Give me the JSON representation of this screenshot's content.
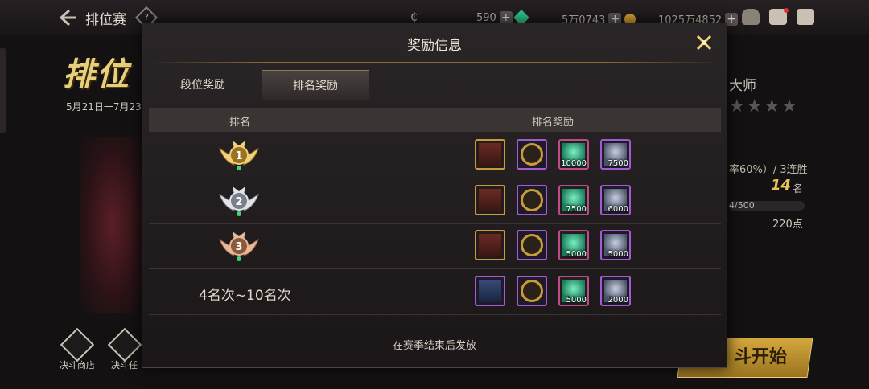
{
  "header": {
    "title": "排位赛",
    "help_symbol": "?",
    "currencies": [
      {
        "name": "currency-a",
        "value": "590",
        "color": "#2fc48a"
      },
      {
        "name": "currency-b",
        "value": "5万0743",
        "color": "#d4a030"
      },
      {
        "name": "currency-c",
        "value": "1025万4852"
      }
    ]
  },
  "background": {
    "banner": "排位",
    "date_range": "5月21日一7月23",
    "right_title": "大师",
    "stars": "★★★★",
    "winrate": "率60%）/ 3连胜",
    "rank_number": "14",
    "rank_suffix": "名",
    "progress_text": "4/500",
    "points": "220点",
    "start_button": "斗开始",
    "bottom_nav": [
      {
        "label": "决斗商店"
      },
      {
        "label": "决斗任"
      }
    ]
  },
  "modal": {
    "title": "奖励信息",
    "tabs": [
      {
        "label": "段位奖励",
        "active": false
      },
      {
        "label": "排名奖励",
        "active": true
      }
    ],
    "columns": {
      "rank": "排名",
      "reward": "排名奖励"
    },
    "rows": [
      {
        "rank": 1,
        "medal_digit": "1",
        "medal_color": "gold",
        "rewards": [
          {
            "kind": "ticket",
            "frame": "gold",
            "qty": ""
          },
          {
            "kind": "medal",
            "frame": "purple",
            "qty": ""
          },
          {
            "kind": "crystal",
            "frame": "pink",
            "qty": "10000"
          },
          {
            "kind": "ore",
            "frame": "purple",
            "qty": "7500"
          }
        ]
      },
      {
        "rank": 2,
        "medal_digit": "2",
        "medal_color": "silver",
        "rewards": [
          {
            "kind": "ticket",
            "frame": "gold",
            "qty": ""
          },
          {
            "kind": "medal",
            "frame": "purple",
            "qty": ""
          },
          {
            "kind": "crystal",
            "frame": "pink",
            "qty": "7500"
          },
          {
            "kind": "ore",
            "frame": "purple",
            "qty": "6000"
          }
        ]
      },
      {
        "rank": 3,
        "medal_digit": "3",
        "medal_color": "bronze",
        "rewards": [
          {
            "kind": "ticket",
            "frame": "gold",
            "qty": ""
          },
          {
            "kind": "medal",
            "frame": "purple",
            "qty": ""
          },
          {
            "kind": "crystal",
            "frame": "pink",
            "qty": "5000"
          },
          {
            "kind": "ore",
            "frame": "purple",
            "qty": "5000"
          }
        ]
      },
      {
        "rank_label": "4名次~10名次",
        "rewards": [
          {
            "kind": "ticket-blue",
            "frame": "purple",
            "qty": ""
          },
          {
            "kind": "medal",
            "frame": "purple",
            "qty": ""
          },
          {
            "kind": "crystal",
            "frame": "pink",
            "qty": "5000"
          },
          {
            "kind": "ore",
            "frame": "purple",
            "qty": "2000"
          }
        ]
      }
    ],
    "footer": "在赛季结束后发放"
  }
}
